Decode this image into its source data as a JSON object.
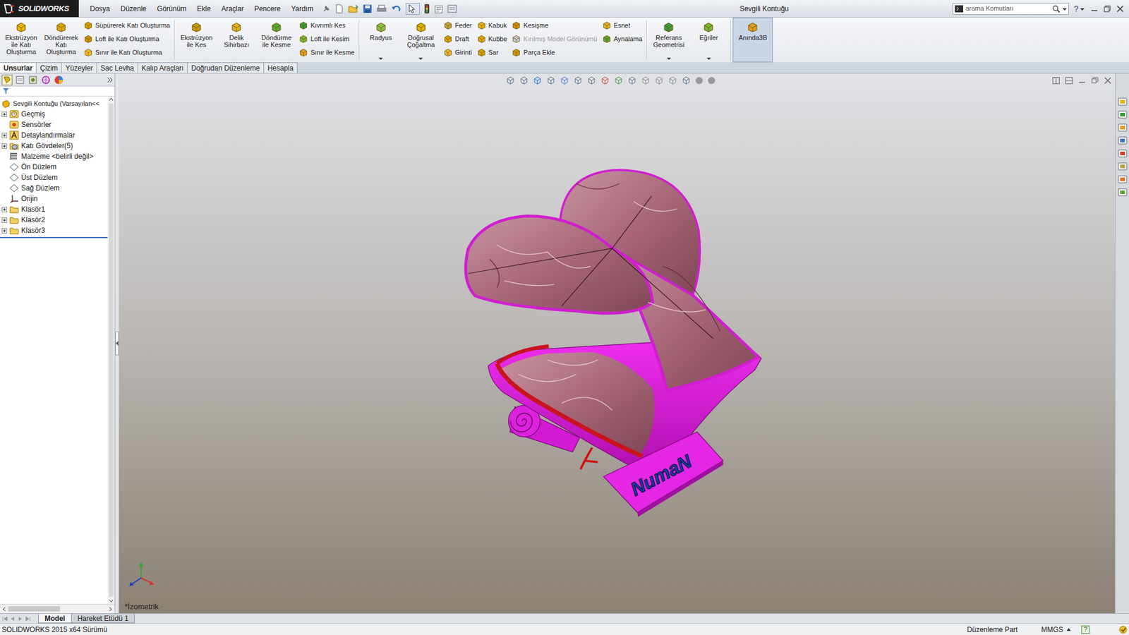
{
  "app": {
    "logo": "SOLIDWORKS",
    "title": "Sevgili Kontuğu"
  },
  "menu": [
    "Dosya",
    "Düzenle",
    "Görünüm",
    "Ekle",
    "Araçlar",
    "Pencere",
    "Yardım"
  ],
  "search": {
    "placeholder": "arama Komutları"
  },
  "help": "?",
  "ribbon": [
    {
      "kind": "large",
      "label": "Ekstrüzyon ile Katı Oluşturma",
      "selected": false,
      "dropdown": false
    },
    {
      "kind": "large",
      "label": "Döndürerek Katı Oluşturma",
      "selected": false,
      "dropdown": false
    },
    {
      "kind": "stack",
      "items": [
        {
          "label": "Süpürerek Katı Oluşturma",
          "disabled": false
        },
        {
          "label": "Loft ile Katı Oluşturma",
          "disabled": false
        },
        {
          "label": "Sınır ile Katı Oluşturma",
          "disabled": false
        }
      ]
    },
    {
      "kind": "separator"
    },
    {
      "kind": "large",
      "label": "Ekstrüzyon ile Kes",
      "selected": false,
      "dropdown": false
    },
    {
      "kind": "large",
      "label": "Delik Sihirbazı",
      "selected": false,
      "dropdown": false
    },
    {
      "kind": "large",
      "label": "Döndürme ile Kesme",
      "selected": false,
      "dropdown": false
    },
    {
      "kind": "stack",
      "items": [
        {
          "label": "Kıvrımlı Kes",
          "disabled": false
        },
        {
          "label": "Loft ile Kesim",
          "disabled": false
        },
        {
          "label": "Sınır ile Kesme",
          "disabled": false
        }
      ]
    },
    {
      "kind": "separator"
    },
    {
      "kind": "large",
      "label": "Radyus",
      "selected": false,
      "dropdown": true
    },
    {
      "kind": "large",
      "label": "Doğrusal Çoğaltma",
      "selected": false,
      "dropdown": true
    },
    {
      "kind": "stack",
      "items": [
        {
          "label": "Feder",
          "disabled": false
        },
        {
          "label": "Draft",
          "disabled": false
        },
        {
          "label": "Girinti",
          "disabled": false
        }
      ]
    },
    {
      "kind": "stack",
      "items": [
        {
          "label": "Kabuk",
          "disabled": false
        },
        {
          "label": "Kubbe",
          "disabled": false
        },
        {
          "label": "Sar",
          "disabled": false
        }
      ]
    },
    {
      "kind": "stack",
      "items": [
        {
          "label": "Kesişme",
          "disabled": false
        },
        {
          "label": "Kırılmış Model Görünümü",
          "disabled": true
        },
        {
          "label": "Parça Ekle",
          "disabled": false
        }
      ]
    },
    {
      "kind": "stack",
      "items": [
        {
          "label": "Esnet",
          "disabled": false
        },
        {
          "label": "Aynalama",
          "disabled": false
        }
      ]
    },
    {
      "kind": "separator"
    },
    {
      "kind": "large",
      "label": "Referans Geometrisi",
      "selected": false,
      "dropdown": true
    },
    {
      "kind": "large",
      "label": "Eğriler",
      "selected": false,
      "dropdown": true
    },
    {
      "kind": "separator"
    },
    {
      "kind": "large",
      "label": "Anında3B",
      "selected": true,
      "dropdown": false
    }
  ],
  "tabs": [
    {
      "label": "Unsurlar",
      "selected": true
    },
    {
      "label": "Çizim",
      "selected": false
    },
    {
      "label": "Yüzeyler",
      "selected": false
    },
    {
      "label": "Sac Levha",
      "selected": false
    },
    {
      "label": "Kalıp Araçları",
      "selected": false
    },
    {
      "label": "Doğrudan Düzenleme",
      "selected": false
    },
    {
      "label": "Hesapla",
      "selected": false
    }
  ],
  "tree": {
    "root": "Sevgili Kontuğu (Varsayılan<<",
    "items": [
      {
        "label": "Geçmiş",
        "kind": "history",
        "expandable": true
      },
      {
        "label": "Sensörler",
        "kind": "sensor",
        "expandable": false
      },
      {
        "label": "Detaylandırmalar",
        "kind": "annotation",
        "expandable": true
      },
      {
        "label": "Katı Gövdeler(5)",
        "kind": "bodies",
        "expandable": true
      },
      {
        "label": "Malzeme <belirli değil>",
        "kind": "material",
        "expandable": false
      },
      {
        "label": "Ön Düzlem",
        "kind": "plane",
        "expandable": false
      },
      {
        "label": "Üst Düzlem",
        "kind": "plane",
        "expandable": false
      },
      {
        "label": "Sağ Düzlem",
        "kind": "plane",
        "expandable": false
      },
      {
        "label": "Orijin",
        "kind": "origin",
        "expandable": false
      },
      {
        "label": "Klasör1",
        "kind": "folder",
        "expandable": true
      },
      {
        "label": "Klasör2",
        "kind": "folder",
        "expandable": true
      },
      {
        "label": "Klasör3",
        "kind": "folder",
        "expandable": true
      }
    ]
  },
  "viewport": {
    "view_name": "*İzometrik",
    "model_label": "NumaN"
  },
  "bottom_tabs": [
    {
      "label": "Model",
      "selected": true
    },
    {
      "label": "Hareket Etüdü 1",
      "selected": false
    }
  ],
  "status_bar": {
    "version": "SOLIDWORKS 2015 x64 Sürümü",
    "mode": "Düzenleme Part",
    "units": "MMGS",
    "help": "?"
  }
}
